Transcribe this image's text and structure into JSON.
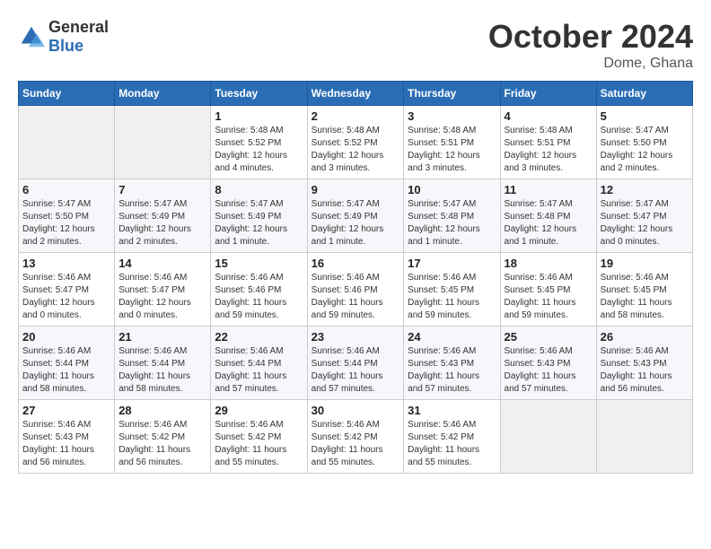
{
  "logo": {
    "general": "General",
    "blue": "Blue"
  },
  "header": {
    "month": "October 2024",
    "location": "Dome, Ghana"
  },
  "weekdays": [
    "Sunday",
    "Monday",
    "Tuesday",
    "Wednesday",
    "Thursday",
    "Friday",
    "Saturday"
  ],
  "weeks": [
    [
      {
        "day": "",
        "sunrise": "",
        "sunset": "",
        "daylight": "",
        "empty": true
      },
      {
        "day": "",
        "sunrise": "",
        "sunset": "",
        "daylight": "",
        "empty": true
      },
      {
        "day": "1",
        "sunrise": "Sunrise: 5:48 AM",
        "sunset": "Sunset: 5:52 PM",
        "daylight": "Daylight: 12 hours and 4 minutes."
      },
      {
        "day": "2",
        "sunrise": "Sunrise: 5:48 AM",
        "sunset": "Sunset: 5:52 PM",
        "daylight": "Daylight: 12 hours and 3 minutes."
      },
      {
        "day": "3",
        "sunrise": "Sunrise: 5:48 AM",
        "sunset": "Sunset: 5:51 PM",
        "daylight": "Daylight: 12 hours and 3 minutes."
      },
      {
        "day": "4",
        "sunrise": "Sunrise: 5:48 AM",
        "sunset": "Sunset: 5:51 PM",
        "daylight": "Daylight: 12 hours and 3 minutes."
      },
      {
        "day": "5",
        "sunrise": "Sunrise: 5:47 AM",
        "sunset": "Sunset: 5:50 PM",
        "daylight": "Daylight: 12 hours and 2 minutes."
      }
    ],
    [
      {
        "day": "6",
        "sunrise": "Sunrise: 5:47 AM",
        "sunset": "Sunset: 5:50 PM",
        "daylight": "Daylight: 12 hours and 2 minutes."
      },
      {
        "day": "7",
        "sunrise": "Sunrise: 5:47 AM",
        "sunset": "Sunset: 5:49 PM",
        "daylight": "Daylight: 12 hours and 2 minutes."
      },
      {
        "day": "8",
        "sunrise": "Sunrise: 5:47 AM",
        "sunset": "Sunset: 5:49 PM",
        "daylight": "Daylight: 12 hours and 1 minute."
      },
      {
        "day": "9",
        "sunrise": "Sunrise: 5:47 AM",
        "sunset": "Sunset: 5:49 PM",
        "daylight": "Daylight: 12 hours and 1 minute."
      },
      {
        "day": "10",
        "sunrise": "Sunrise: 5:47 AM",
        "sunset": "Sunset: 5:48 PM",
        "daylight": "Daylight: 12 hours and 1 minute."
      },
      {
        "day": "11",
        "sunrise": "Sunrise: 5:47 AM",
        "sunset": "Sunset: 5:48 PM",
        "daylight": "Daylight: 12 hours and 1 minute."
      },
      {
        "day": "12",
        "sunrise": "Sunrise: 5:47 AM",
        "sunset": "Sunset: 5:47 PM",
        "daylight": "Daylight: 12 hours and 0 minutes."
      }
    ],
    [
      {
        "day": "13",
        "sunrise": "Sunrise: 5:46 AM",
        "sunset": "Sunset: 5:47 PM",
        "daylight": "Daylight: 12 hours and 0 minutes."
      },
      {
        "day": "14",
        "sunrise": "Sunrise: 5:46 AM",
        "sunset": "Sunset: 5:47 PM",
        "daylight": "Daylight: 12 hours and 0 minutes."
      },
      {
        "day": "15",
        "sunrise": "Sunrise: 5:46 AM",
        "sunset": "Sunset: 5:46 PM",
        "daylight": "Daylight: 11 hours and 59 minutes."
      },
      {
        "day": "16",
        "sunrise": "Sunrise: 5:46 AM",
        "sunset": "Sunset: 5:46 PM",
        "daylight": "Daylight: 11 hours and 59 minutes."
      },
      {
        "day": "17",
        "sunrise": "Sunrise: 5:46 AM",
        "sunset": "Sunset: 5:45 PM",
        "daylight": "Daylight: 11 hours and 59 minutes."
      },
      {
        "day": "18",
        "sunrise": "Sunrise: 5:46 AM",
        "sunset": "Sunset: 5:45 PM",
        "daylight": "Daylight: 11 hours and 59 minutes."
      },
      {
        "day": "19",
        "sunrise": "Sunrise: 5:46 AM",
        "sunset": "Sunset: 5:45 PM",
        "daylight": "Daylight: 11 hours and 58 minutes."
      }
    ],
    [
      {
        "day": "20",
        "sunrise": "Sunrise: 5:46 AM",
        "sunset": "Sunset: 5:44 PM",
        "daylight": "Daylight: 11 hours and 58 minutes."
      },
      {
        "day": "21",
        "sunrise": "Sunrise: 5:46 AM",
        "sunset": "Sunset: 5:44 PM",
        "daylight": "Daylight: 11 hours and 58 minutes."
      },
      {
        "day": "22",
        "sunrise": "Sunrise: 5:46 AM",
        "sunset": "Sunset: 5:44 PM",
        "daylight": "Daylight: 11 hours and 57 minutes."
      },
      {
        "day": "23",
        "sunrise": "Sunrise: 5:46 AM",
        "sunset": "Sunset: 5:44 PM",
        "daylight": "Daylight: 11 hours and 57 minutes."
      },
      {
        "day": "24",
        "sunrise": "Sunrise: 5:46 AM",
        "sunset": "Sunset: 5:43 PM",
        "daylight": "Daylight: 11 hours and 57 minutes."
      },
      {
        "day": "25",
        "sunrise": "Sunrise: 5:46 AM",
        "sunset": "Sunset: 5:43 PM",
        "daylight": "Daylight: 11 hours and 57 minutes."
      },
      {
        "day": "26",
        "sunrise": "Sunrise: 5:46 AM",
        "sunset": "Sunset: 5:43 PM",
        "daylight": "Daylight: 11 hours and 56 minutes."
      }
    ],
    [
      {
        "day": "27",
        "sunrise": "Sunrise: 5:46 AM",
        "sunset": "Sunset: 5:43 PM",
        "daylight": "Daylight: 11 hours and 56 minutes."
      },
      {
        "day": "28",
        "sunrise": "Sunrise: 5:46 AM",
        "sunset": "Sunset: 5:42 PM",
        "daylight": "Daylight: 11 hours and 56 minutes."
      },
      {
        "day": "29",
        "sunrise": "Sunrise: 5:46 AM",
        "sunset": "Sunset: 5:42 PM",
        "daylight": "Daylight: 11 hours and 55 minutes."
      },
      {
        "day": "30",
        "sunrise": "Sunrise: 5:46 AM",
        "sunset": "Sunset: 5:42 PM",
        "daylight": "Daylight: 11 hours and 55 minutes."
      },
      {
        "day": "31",
        "sunrise": "Sunrise: 5:46 AM",
        "sunset": "Sunset: 5:42 PM",
        "daylight": "Daylight: 11 hours and 55 minutes."
      },
      {
        "day": "",
        "sunrise": "",
        "sunset": "",
        "daylight": "",
        "empty": true
      },
      {
        "day": "",
        "sunrise": "",
        "sunset": "",
        "daylight": "",
        "empty": true
      }
    ]
  ]
}
